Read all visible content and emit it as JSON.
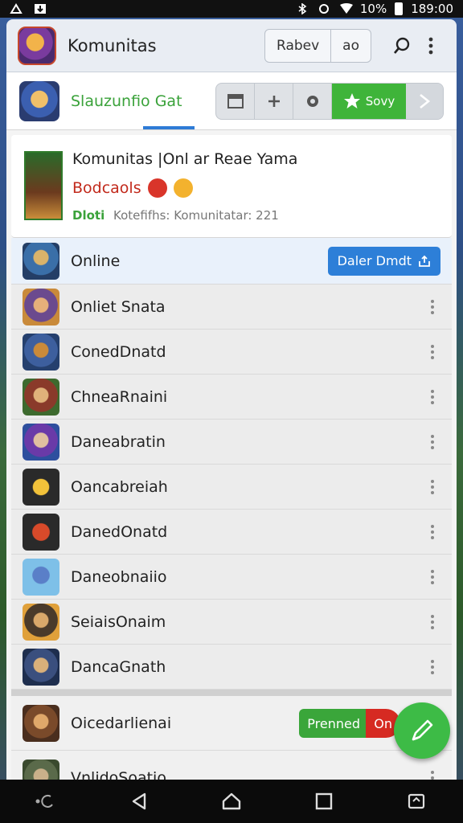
{
  "status_bar": {
    "battery_text": "10%",
    "time": "189:00"
  },
  "app_header": {
    "title": "Komunitas",
    "segment_left": "Rabev",
    "segment_right": "ao"
  },
  "sub_header": {
    "title": "Slauzunfio Gat",
    "star_button": "Sovy"
  },
  "info_card": {
    "title": "Komunitas |Onl ar Reae Yama",
    "subtitle": "Bodcaols",
    "meta_label": "Dloti",
    "meta_text": "Kotefifhs: Komunitatar: 221"
  },
  "list": {
    "highlight": {
      "label": "Online",
      "button_label": "Daler Dmdt"
    },
    "items": [
      {
        "label": "Onliet Snata"
      },
      {
        "label": "ConedDnatd"
      },
      {
        "label": "ChneaRnaini"
      },
      {
        "label": "Daneabratin"
      },
      {
        "label": "Oancabreiah"
      },
      {
        "label": "DanedOnatd"
      },
      {
        "label": "Daneobnaiio"
      },
      {
        "label": "SeiaisOnaim"
      },
      {
        "label": "DancaGnath"
      }
    ],
    "bottom_items": [
      {
        "label": "Oicedarlienai",
        "pill_green": "Prenned",
        "pill_red": "On"
      },
      {
        "label": "VnlidoSoatio"
      }
    ]
  },
  "colors": {
    "accent_blue": "#2d7fd8",
    "accent_green": "#3fb43a",
    "accent_red": "#d62a22"
  }
}
